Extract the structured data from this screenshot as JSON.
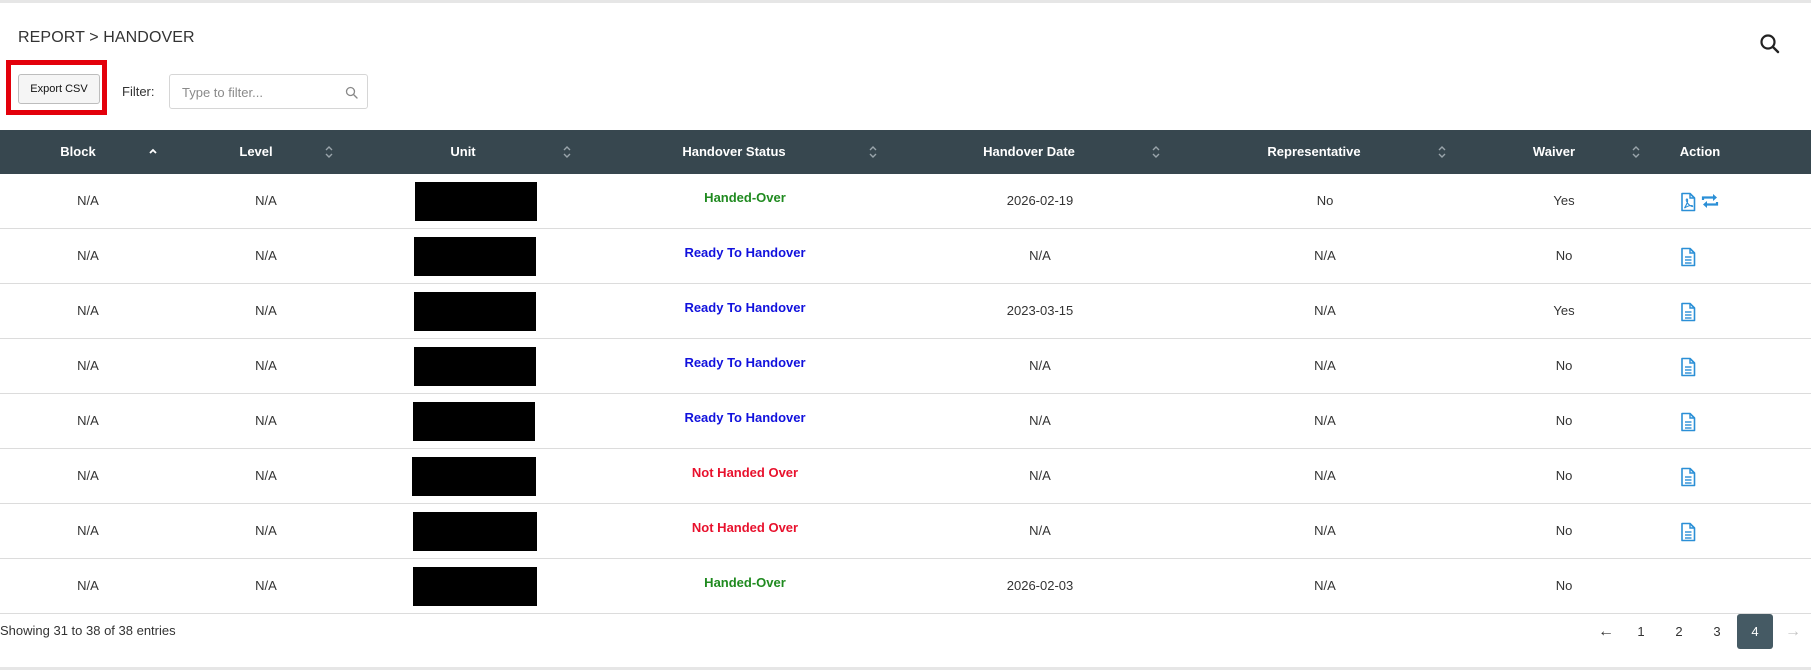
{
  "breadcrumb": "REPORT > HANDOVER",
  "toolbar": {
    "export_label": "Export CSV",
    "filter_label": "Filter:",
    "filter_placeholder": "Type to filter...",
    "filter_value": ""
  },
  "table": {
    "columns": [
      "Block",
      "Level",
      "Unit",
      "Handover Status",
      "Handover Date",
      "Representative",
      "Waiver",
      "Action"
    ],
    "rows": [
      {
        "block": "N/A",
        "level": "N/A",
        "unit": "",
        "status": "Handed-Over",
        "status_color": "#1f8a1f",
        "date": "2026-02-19",
        "representative": "No",
        "waiver": "Yes",
        "actions": [
          "pdf-icon",
          "sync-icon"
        ]
      },
      {
        "block": "N/A",
        "level": "N/A",
        "unit": "",
        "status": "Ready To Handover",
        "status_color": "#1111dd",
        "date": "N/A",
        "representative": "N/A",
        "waiver": "No",
        "actions": [
          "document-icon"
        ]
      },
      {
        "block": "N/A",
        "level": "N/A",
        "unit": "",
        "status": "Ready To Handover",
        "status_color": "#1111dd",
        "date": "2023-03-15",
        "representative": "N/A",
        "waiver": "Yes",
        "actions": [
          "document-icon"
        ]
      },
      {
        "block": "N/A",
        "level": "N/A",
        "unit": "",
        "status": "Ready To Handover",
        "status_color": "#1111dd",
        "date": "N/A",
        "representative": "N/A",
        "waiver": "No",
        "actions": [
          "document-icon"
        ]
      },
      {
        "block": "N/A",
        "level": "N/A",
        "unit": "",
        "status": "Ready To Handover",
        "status_color": "#1111dd",
        "date": "N/A",
        "representative": "N/A",
        "waiver": "No",
        "actions": [
          "document-icon"
        ]
      },
      {
        "block": "N/A",
        "level": "N/A",
        "unit": "",
        "status": "Not Handed Over",
        "status_color": "#e8112d",
        "date": "N/A",
        "representative": "N/A",
        "waiver": "No",
        "actions": [
          "document-icon"
        ]
      },
      {
        "block": "N/A",
        "level": "N/A",
        "unit": "",
        "status": "Not Handed Over",
        "status_color": "#e8112d",
        "date": "N/A",
        "representative": "N/A",
        "waiver": "No",
        "actions": [
          "document-icon"
        ]
      },
      {
        "block": "N/A",
        "level": "N/A",
        "unit": "",
        "status": "Handed-Over",
        "status_color": "#1f8a1f",
        "date": "2026-02-03",
        "representative": "N/A",
        "waiver": "No",
        "actions": []
      }
    ]
  },
  "footer": {
    "info": "Showing 31 to 38 of 38 entries",
    "prev": "←",
    "pages": [
      "1",
      "2",
      "3",
      "4"
    ],
    "current_page": "4",
    "next": "→"
  },
  "colors": {
    "header_bg": "#37474f",
    "highlight_border": "#e3000b",
    "icon_blue": "#2b8fd6",
    "pager_active": "#455a64"
  }
}
